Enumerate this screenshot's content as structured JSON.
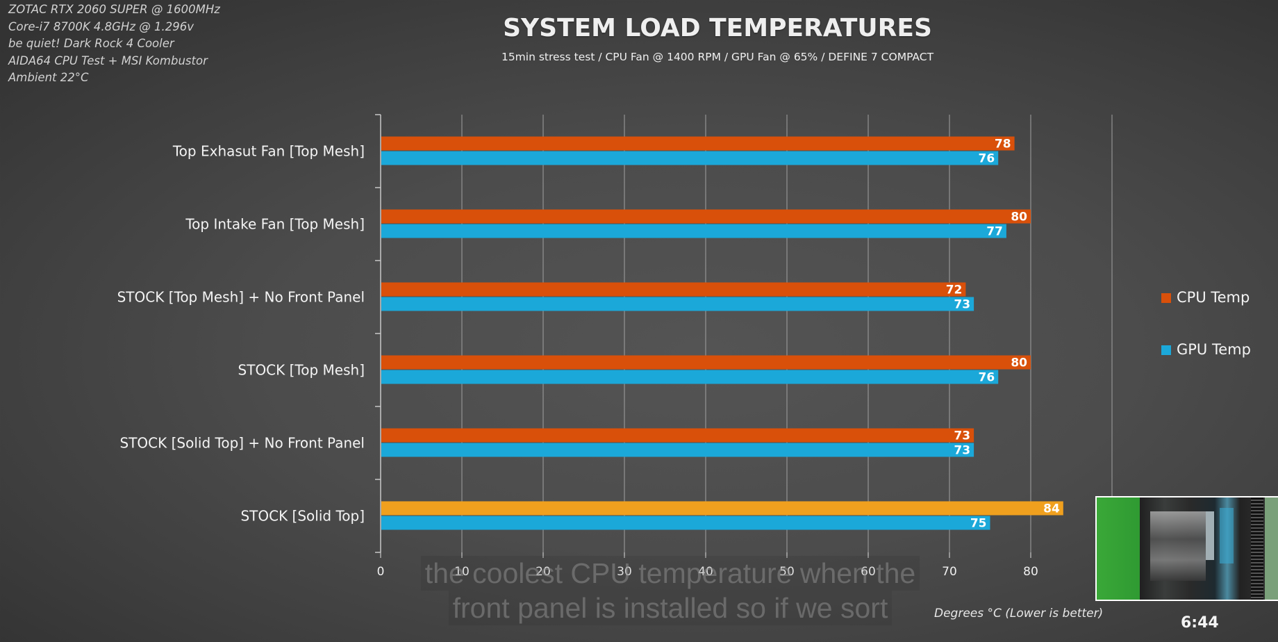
{
  "specs": [
    "ZOTAC RTX 2060 SUPER @ 1600MHz",
    "Core-i7 8700K 4.8GHz @ 1.296v",
    "be quiet! Dark Rock 4 Cooler",
    "AIDA64 CPU Test + MSI Kombustor",
    "Ambient 22°C"
  ],
  "caption": {
    "line1": "the coolest CPU temperature when the",
    "line2": "front panel is installed so if we sort"
  },
  "video": {
    "timestamp": "6:44",
    "thumbnail": "case-interior-preview"
  },
  "colors": {
    "cpu": "#d9500a",
    "gpu": "#1ba8d9",
    "cpu_highlight": "#f0a01e",
    "grid": "#9a9a9a",
    "axis": "#c8c8c8",
    "text": "#f2f2f2"
  },
  "chart_data": {
    "type": "bar",
    "orientation": "horizontal",
    "title": "SYSTEM LOAD TEMPERATURES",
    "subtitle": "15min stress test / CPU Fan @ 1400 RPM / GPU Fan @ 65% / DEFINE 7 COMPACT",
    "xlabel": "Degrees °C (Lower is better)",
    "ylabel": "",
    "xlim": [
      0,
      90
    ],
    "xticks": [
      0,
      10,
      20,
      30,
      40,
      50,
      60,
      70,
      80
    ],
    "grid": true,
    "legend_position": "right",
    "categories": [
      "Top Exhasut Fan [Top Mesh]",
      "Top Intake Fan [Top Mesh]",
      "STOCK [Top Mesh] + No Front Panel",
      "STOCK [Top Mesh]",
      "STOCK [Solid Top] + No Front Panel",
      "STOCK [Solid Top]"
    ],
    "series": [
      {
        "name": "CPU Temp",
        "values": [
          78,
          80,
          72,
          80,
          73,
          84
        ],
        "highlight_index": 5
      },
      {
        "name": "GPU Temp",
        "values": [
          76,
          77,
          73,
          76,
          73,
          75
        ]
      }
    ],
    "data_labels": true
  }
}
